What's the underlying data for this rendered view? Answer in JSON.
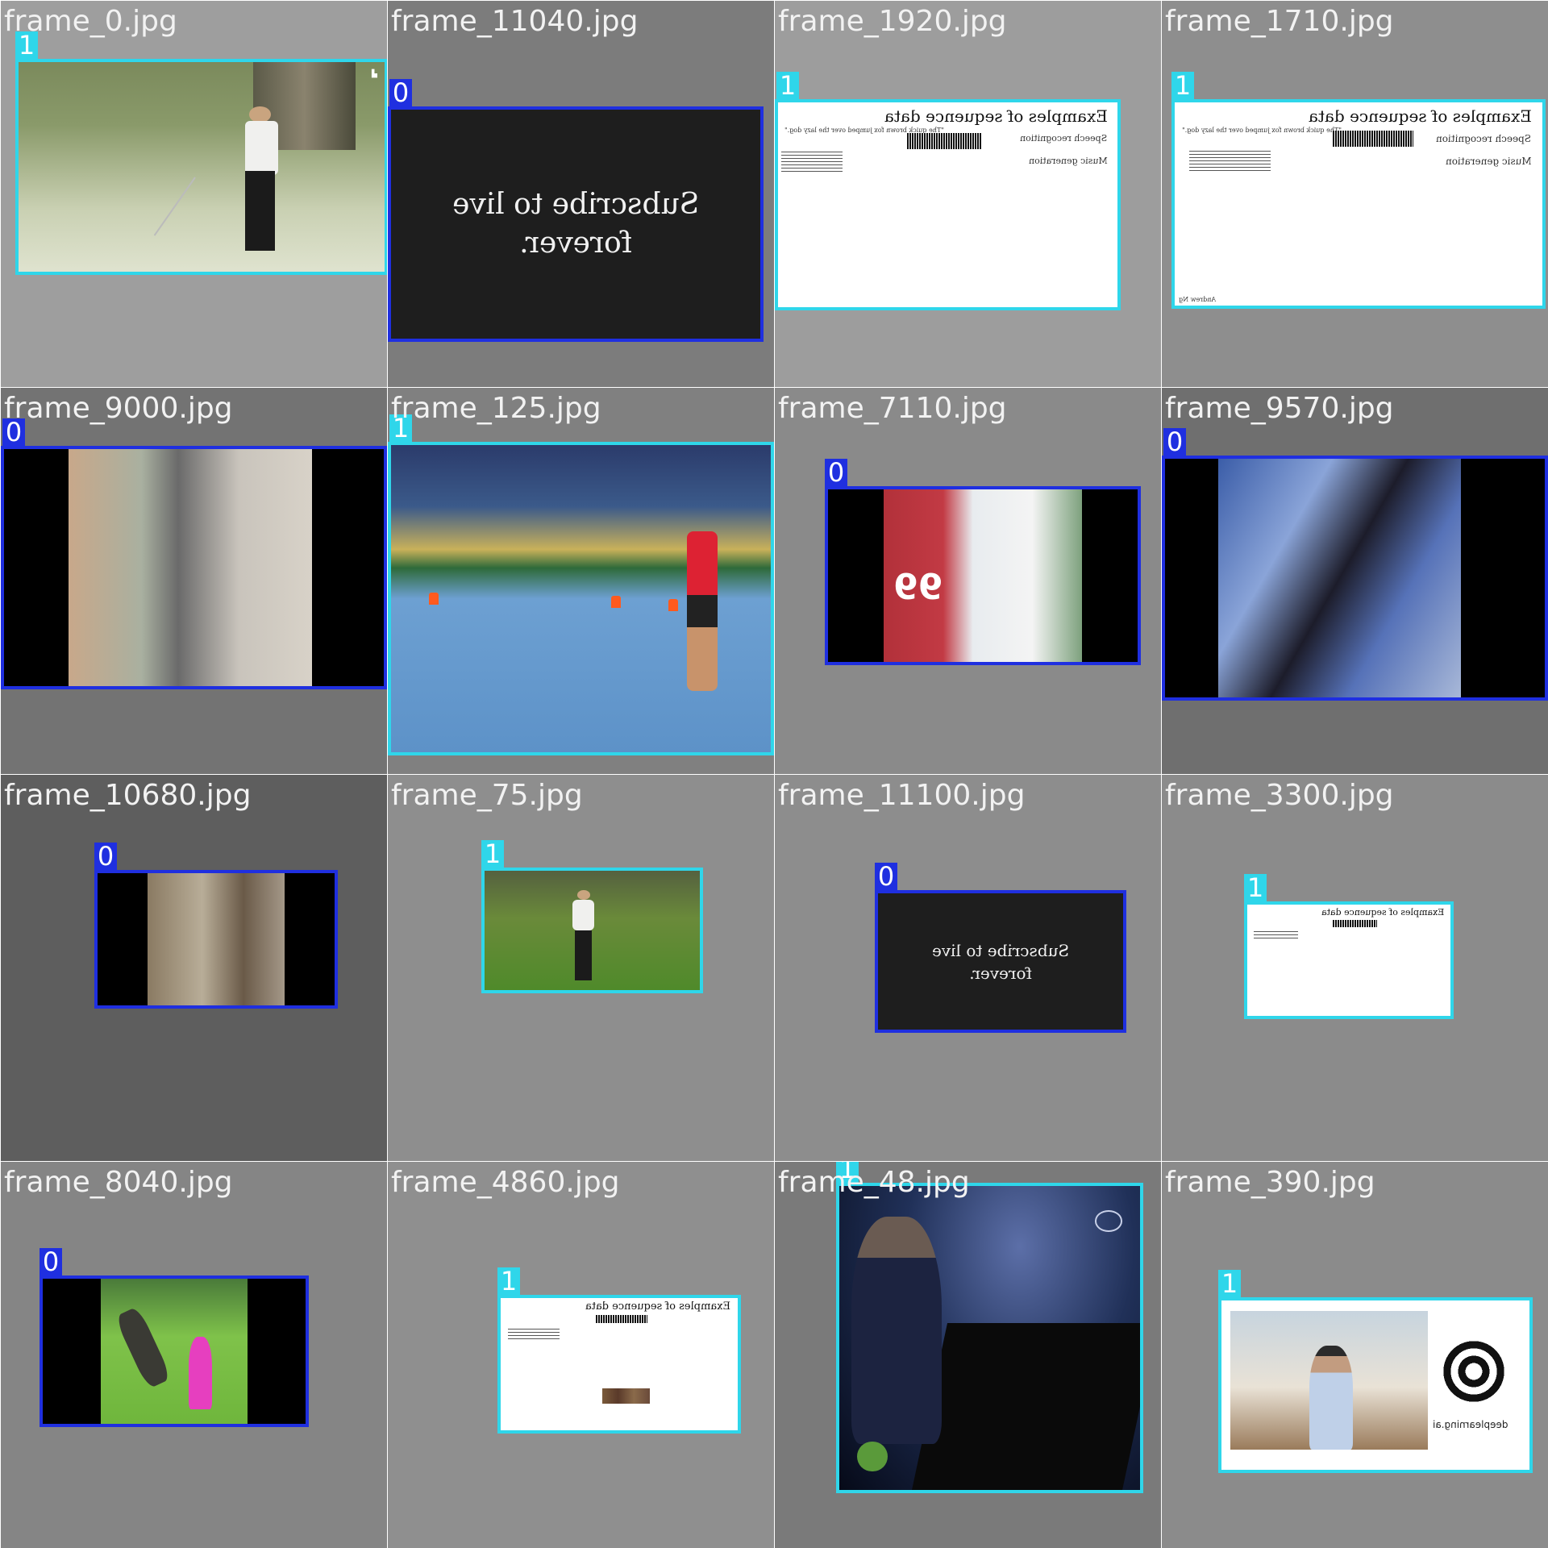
{
  "colors": {
    "class_0": "#1f2fe0",
    "class_1": "#2fd6ea"
  },
  "cells": [
    {
      "filename": "frame_0.jpg",
      "class_label": "1",
      "bg": "#9e9e9e"
    },
    {
      "filename": "frame_11040.jpg",
      "class_label": "0",
      "bg": "#7c7c7c",
      "slide_text_line1": "Subscribe to live",
      "slide_text_line2": "forever."
    },
    {
      "filename": "frame_1920.jpg",
      "class_label": "1",
      "bg": "#9d9d9d",
      "slide_title": "Examples of sequence data",
      "row1": "Speech recognition",
      "row2": "Music generation",
      "quote": "\"The quick brown fox jumped over the lazy dog.\""
    },
    {
      "filename": "frame_1710.jpg",
      "class_label": "1",
      "bg": "#8e8e8e",
      "slide_title": "Examples of sequence data",
      "row1": "Speech recognition",
      "row2": "Music generation",
      "quote": "\"The quick brown fox jumped over the lazy dog.\"",
      "footer": "Andrew Ng"
    },
    {
      "filename": "frame_9000.jpg",
      "class_label": "0",
      "bg": "#737373"
    },
    {
      "filename": "frame_125.jpg",
      "class_label": "1",
      "bg": "#808080"
    },
    {
      "filename": "frame_7110.jpg",
      "class_label": "0",
      "bg": "#8a8a8a",
      "jersey": "99"
    },
    {
      "filename": "frame_9570.jpg",
      "class_label": "0",
      "bg": "#6f6f6f"
    },
    {
      "filename": "frame_10680.jpg",
      "class_label": "0",
      "bg": "#5e5e5e"
    },
    {
      "filename": "frame_75.jpg",
      "class_label": "1",
      "bg": "#8e8e8e"
    },
    {
      "filename": "frame_11100.jpg",
      "class_label": "0",
      "bg": "#8d8d8d",
      "slide_text_line1": "Subscribe to live",
      "slide_text_line2": "forever."
    },
    {
      "filename": "frame_3300.jpg",
      "class_label": "1",
      "bg": "#8b8b8b",
      "slide_title": "Examples of sequence data"
    },
    {
      "filename": "frame_8040.jpg",
      "class_label": "0",
      "bg": "#858585"
    },
    {
      "filename": "frame_4860.jpg",
      "class_label": "1",
      "bg": "#8f8f8f",
      "slide_title": "Examples of sequence data"
    },
    {
      "filename": "frame_48.jpg",
      "class_label": "1",
      "bg": "#7a7a7a"
    },
    {
      "filename": "frame_390.jpg",
      "class_label": "1",
      "bg": "#8b8b8b",
      "brand": "deeplearning.ai"
    }
  ]
}
